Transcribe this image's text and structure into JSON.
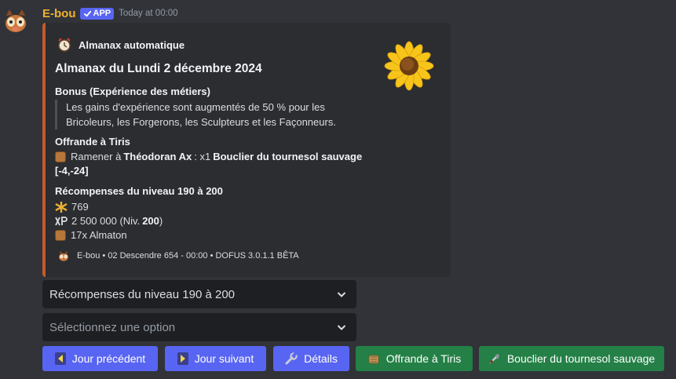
{
  "message": {
    "author": "E-bou",
    "app_badge": "APP",
    "timestamp": "Today at 00:00"
  },
  "embed": {
    "author_name": "Almanax automatique",
    "title": "Almanax du Lundi 2 décembre 2024",
    "accent_color": "#c45a2b",
    "bonus": {
      "name": "Bonus (Expérience des métiers)",
      "description_line1": "Les gains d'expérience sont augmentés de 50 % pour les",
      "description_line2": "Bricoleurs, les Forgerons, les Sculpteurs et les Façonneurs."
    },
    "offering": {
      "name": "Offrande à Tiris",
      "prefix": "Ramener à",
      "npc": "Théodoran Ax",
      "separator": ": x1",
      "item": "Bouclier du tournesol sauvage",
      "coords": "[-4,-24]"
    },
    "rewards": {
      "name": "Récompenses du niveau 190 à 200",
      "kamas": "769",
      "xp_value": "2 500 000 (Niv.",
      "xp_level": "200",
      "xp_close": ")",
      "almaton": "17x Almaton"
    },
    "footer": "E-bou • 02 Descendre 654 - 00:00 • DOFUS 3.0.1.1 BÊTA"
  },
  "selects": {
    "level_value": "Récompenses du niveau 190 à 200",
    "option_placeholder": "Sélectionnez une option"
  },
  "buttons": {
    "prev": "Jour précédent",
    "next": "Jour suivant",
    "details": "Détails",
    "offering": "Offrande à Tiris",
    "item": "Bouclier du tournesol sauvage"
  },
  "icons": {
    "app_check": "check-icon",
    "kamas": "kamas-icon",
    "xp": "xp-icon",
    "almaton": "almaton-icon",
    "prev": "arrow-left-icon",
    "next": "arrow-right-icon",
    "details": "wrench-icon",
    "offering": "offering-icon",
    "item": "shield-icon"
  },
  "colors": {
    "background": "#313338",
    "embed_bg": "#2b2d31",
    "author": "#f0b232",
    "blurple": "#5865f2",
    "green": "#248046"
  }
}
